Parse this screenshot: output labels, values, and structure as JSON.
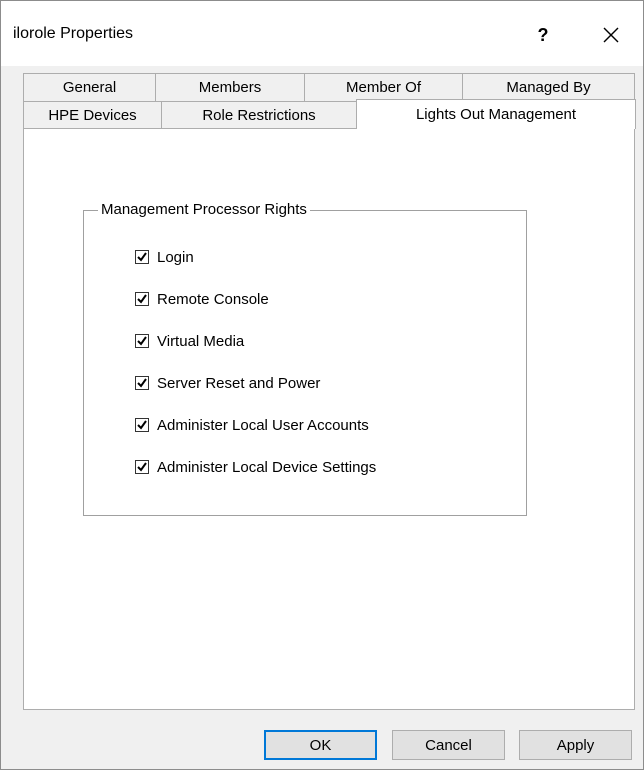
{
  "window": {
    "title": "ilorole Properties"
  },
  "titlebar": {
    "help_label": "?"
  },
  "tabs_row1": [
    {
      "label": "General"
    },
    {
      "label": "Members"
    },
    {
      "label": "Member Of"
    },
    {
      "label": "Managed By"
    }
  ],
  "tabs_row2": [
    {
      "label": "HPE Devices"
    },
    {
      "label": "Role Restrictions"
    },
    {
      "label": "Lights Out Management",
      "active": true
    }
  ],
  "group": {
    "label": "Management Processor Rights",
    "items": [
      {
        "label": "Login",
        "checked": true
      },
      {
        "label": "Remote Console",
        "checked": true
      },
      {
        "label": "Virtual Media",
        "checked": true
      },
      {
        "label": "Server Reset and Power",
        "checked": true
      },
      {
        "label": "Administer Local User Accounts",
        "checked": true
      },
      {
        "label": "Administer Local Device Settings",
        "checked": true
      }
    ]
  },
  "buttons": {
    "ok": "OK",
    "cancel": "Cancel",
    "apply": "Apply"
  },
  "icons": {
    "close": "close-icon",
    "check": "checkmark-icon"
  }
}
